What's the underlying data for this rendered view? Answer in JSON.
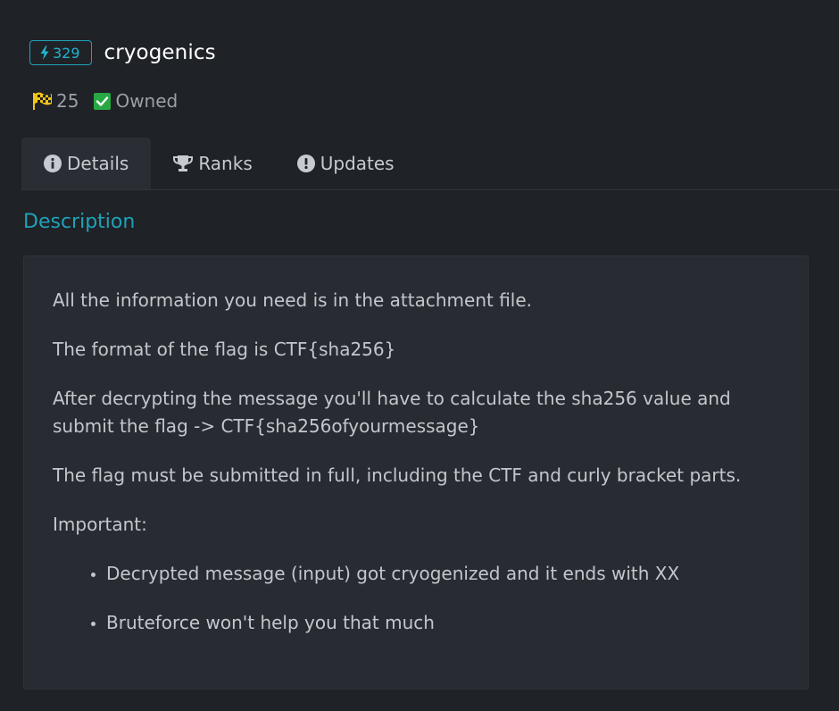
{
  "challenge": {
    "points": "329",
    "title": "cryogenics",
    "solves": "25",
    "status": "Owned"
  },
  "tabs": [
    {
      "label": "Details",
      "icon": "info-circle-icon",
      "active": true
    },
    {
      "label": "Ranks",
      "icon": "trophy-icon",
      "active": false
    },
    {
      "label": "Updates",
      "icon": "exclamation-circle-icon",
      "active": false
    }
  ],
  "section": {
    "title": "Description"
  },
  "description": {
    "paragraphs": [
      "All the information you need is in the attachment file.",
      "The format of the flag is CTF{sha256}",
      "After decrypting the message you'll have to calculate the sha256 value and submit the flag -> CTF{sha256ofyourmessage}",
      "The flag must be submitted in full, including the CTF and curly bracket parts.",
      "Important:"
    ],
    "bullets": [
      "Decrypted message (input) got cryogenized and it ends with XX",
      "Bruteforce won't help you that much"
    ]
  },
  "colors": {
    "background": "#1f2227",
    "card": "#282b31",
    "accent": "#1fa2b8",
    "owned_green": "#27a844",
    "flag_yellow": "#f0c419"
  }
}
